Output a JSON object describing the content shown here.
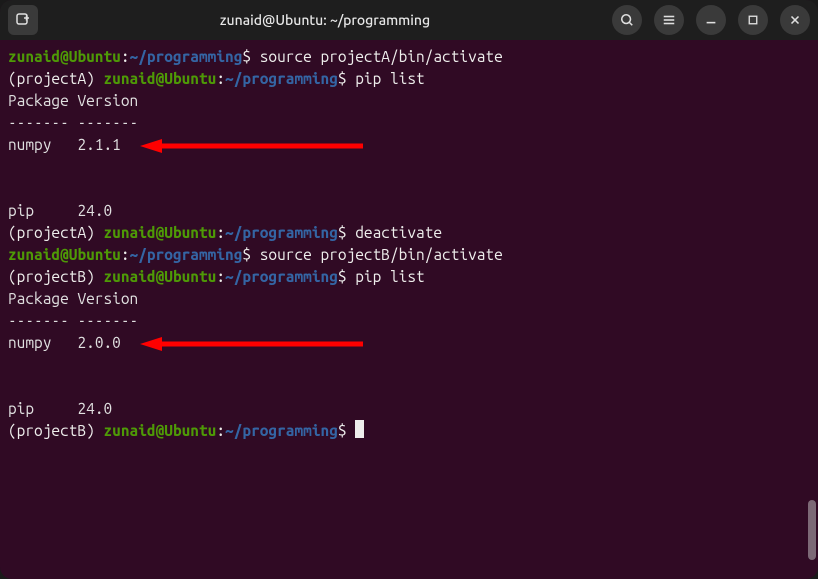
{
  "titlebar": {
    "title": "zunaid@Ubuntu: ~/programming",
    "icons": {
      "new_tab": "new-tab-icon",
      "search": "search-icon",
      "menu": "menu-icon",
      "minimize": "minimize-icon",
      "maximize": "maximize-icon",
      "close": "close-icon"
    }
  },
  "colors": {
    "terminal_bg": "#300a24",
    "user_host_green": "#4e9a06",
    "path_blue": "#3465a4",
    "text_white": "#eeeeec",
    "arrow_red": "#ff0000"
  },
  "prompt": {
    "user_host": "zunaid@Ubuntu",
    "colon": ":",
    "path": "~/programming",
    "dollar": "$"
  },
  "venv": {
    "a": "(projectA)",
    "b": "(projectB)"
  },
  "commands": {
    "activate_a": "source projectA/bin/activate",
    "pip_list": "pip list",
    "deactivate": "deactivate",
    "activate_b": "source projectB/bin/activate"
  },
  "pip_output": {
    "header": "Package Version",
    "divider": "------- -------",
    "list_a": [
      {
        "pkg": "numpy  ",
        "ver": "2.1.1"
      },
      {
        "pkg": "pip    ",
        "ver": "24.0"
      }
    ],
    "list_b": [
      {
        "pkg": "numpy  ",
        "ver": "2.0.0"
      },
      {
        "pkg": "pip    ",
        "ver": "24.0"
      }
    ]
  },
  "arrows": [
    {
      "target": "numpy 2.1.1",
      "line_index": 4
    },
    {
      "target": "numpy 2.0.0",
      "line_index": 11
    }
  ]
}
